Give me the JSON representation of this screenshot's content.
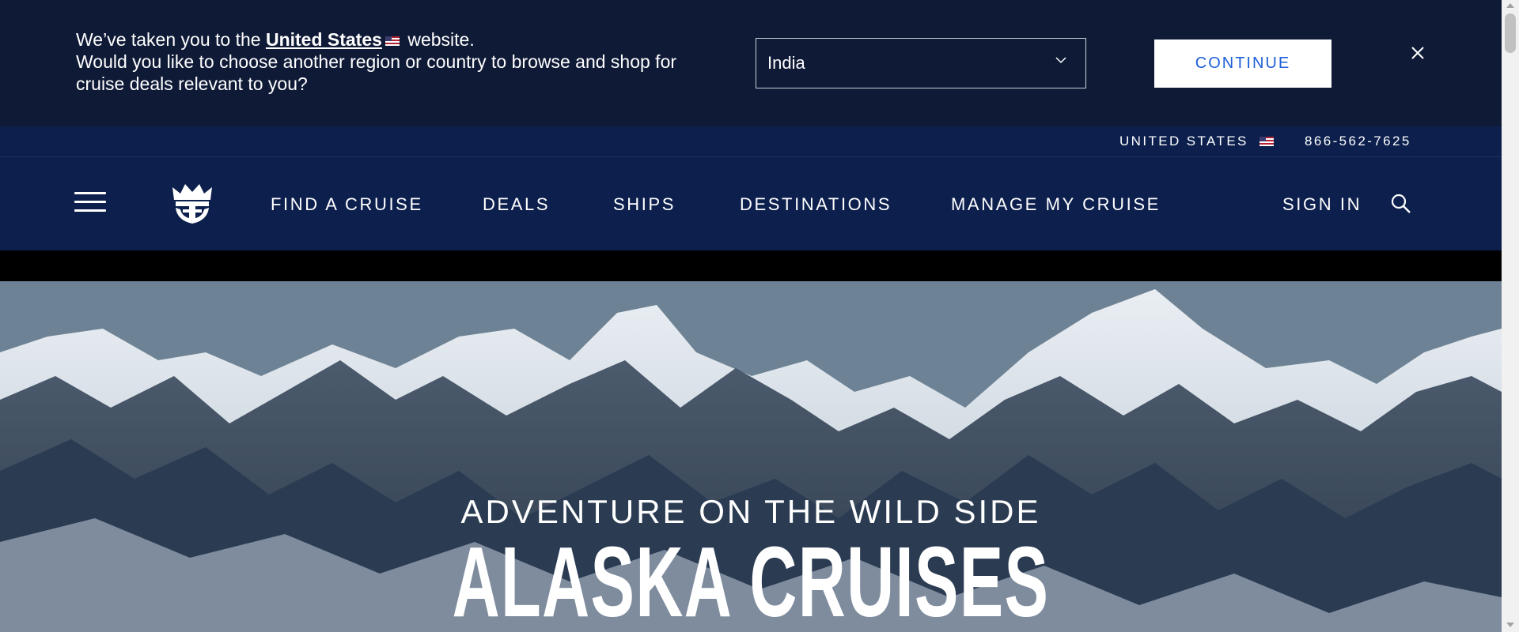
{
  "banner": {
    "msg_prefix": "We’ve taken you to the",
    "link_text": "United States",
    "msg_suffix": "website.",
    "line2": "Would you like to choose another region or country to browse and shop for cruise deals relevant to you?",
    "selected_country": "India",
    "continue_label": "CONTINUE",
    "icons": {
      "flag": "us-flag-icon",
      "dropdown": "chevron-down-icon",
      "close": "close-icon"
    }
  },
  "utility": {
    "country_label": "UNITED STATES",
    "phone": "866-562-7625"
  },
  "nav": {
    "items": [
      "FIND A CRUISE",
      "DEALS",
      "SHIPS",
      "DESTINATIONS",
      "MANAGE MY CRUISE"
    ],
    "sign_in": "SIGN IN",
    "icons": {
      "menu": "hamburger-menu-icon",
      "logo": "crown-anchor-logo-icon",
      "search": "search-icon"
    }
  },
  "hero": {
    "subtitle": "ADVENTURE ON THE WILD SIDE",
    "title": "ALASKA CRUISES"
  },
  "colors": {
    "banner_bg": "#0f1a36",
    "nav_bg": "#0c1f4d",
    "accent_blue": "#1d5fd6",
    "white": "#ffffff"
  }
}
